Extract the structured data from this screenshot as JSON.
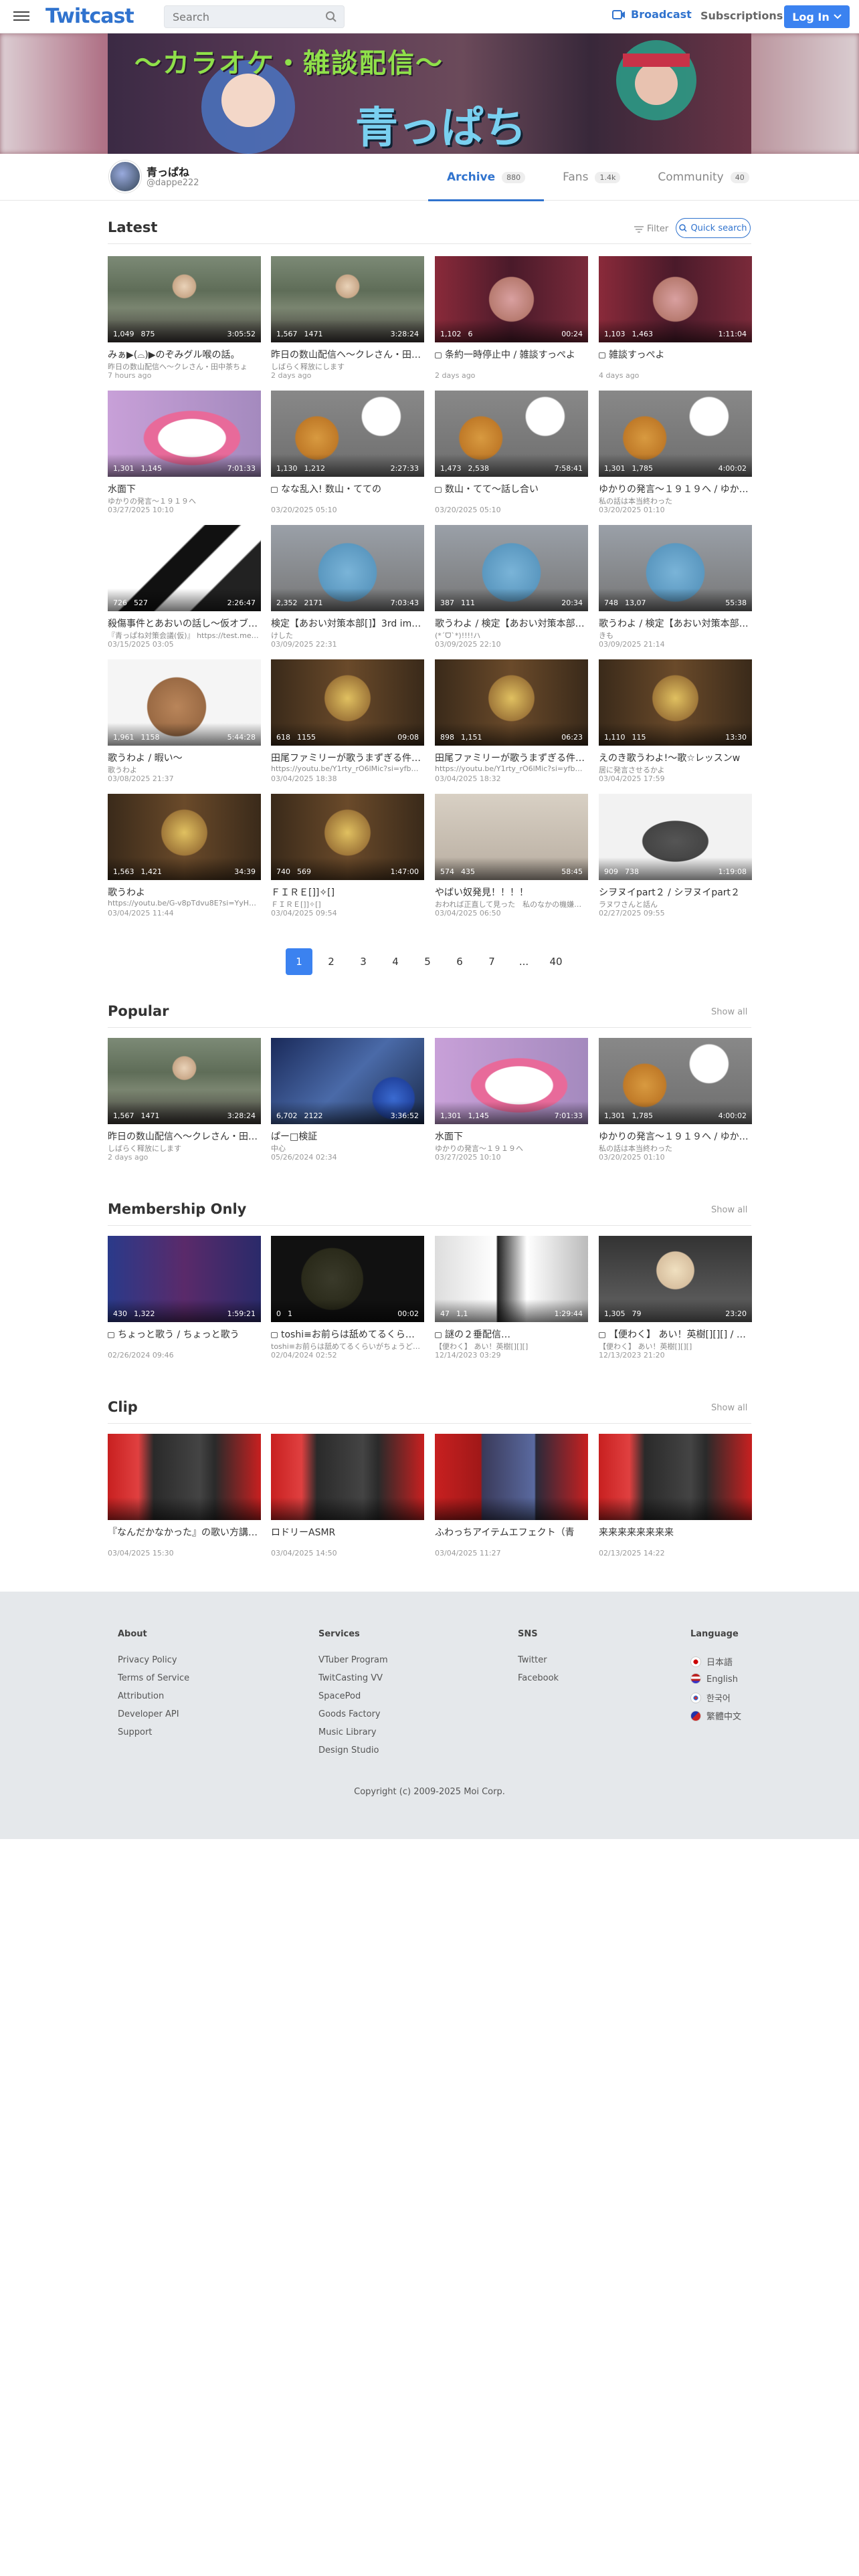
{
  "header": {
    "logo": "Twitcast",
    "search_placeholder": "Search",
    "broadcast": "Broadcast",
    "subscriptions": "Subscriptions",
    "login": "Log In"
  },
  "banner": {
    "title": "〜カラオケ・雑談配信〜",
    "name": "青っぱち"
  },
  "channel": {
    "name": "青っぱね",
    "id": "@dappe222"
  },
  "tabs": [
    {
      "label": "Archive",
      "count": "880"
    },
    {
      "label": "Fans",
      "count": "1.4k"
    },
    {
      "label": "Community",
      "count": "40"
    }
  ],
  "latest": {
    "title": "Latest",
    "filter": "Filter",
    "quick_search": "Quick search",
    "items": [
      {
        "title": "みぁ▶(⌓)▶のぞみグル喉の話。",
        "sub": "昨日の数山配信ヘ〜クレさん・田中茶ちょ",
        "date": "7 hours ago",
        "views": "1,049",
        "comments": "875",
        "dur": "3:05:52",
        "lock": false,
        "thumb": "t-oldman"
      },
      {
        "title": "昨日の数山配信ヘ〜クレさん・田…",
        "sub": "しばらく释放にします",
        "date": "2 days ago",
        "views": "1,567",
        "comments": "1471",
        "dur": "3:28:24",
        "lock": false,
        "thumb": "t-oldman"
      },
      {
        "title": "条約一時停止中 / 雑談すっぺよ",
        "sub": "",
        "date": "2 days ago",
        "views": "1,102",
        "comments": "6",
        "dur": "00:24",
        "lock": true,
        "thumb": "t-pig"
      },
      {
        "title": "雑談すっぺよ",
        "sub": "",
        "date": "4 days ago",
        "views": "1,103",
        "comments": "1,463",
        "dur": "1:11:04",
        "lock": true,
        "thumb": "t-pig"
      },
      {
        "title": "水面下",
        "sub": "ゆかりの発言〜１９１９へ",
        "date": "03/27/2025 10:10",
        "views": "1,301",
        "comments": "1,145",
        "dur": "7:01:33",
        "lock": false,
        "thumb": "t-melody"
      },
      {
        "title": "なな乱入! 数山・てての",
        "sub": "",
        "date": "03/20/2025 05:10",
        "views": "1,130",
        "comments": "1,212",
        "dur": "2:27:33",
        "lock": true,
        "thumb": "t-cat"
      },
      {
        "title": "数山・てて〜話し合い",
        "sub": "",
        "date": "03/20/2025 05:10",
        "views": "1,473",
        "comments": "2,538",
        "dur": "7:58:41",
        "lock": true,
        "thumb": "t-cat"
      },
      {
        "title": "ゆかりの発言〜１９１９へ / ゆかり…",
        "sub": "私の話は本当終わった",
        "date": "03/20/2025 01:10",
        "views": "1,301",
        "comments": "1,785",
        "dur": "4:00:02",
        "lock": false,
        "thumb": "t-cat"
      },
      {
        "title": "殺傷事件とあおいの話し〜仮オブ…",
        "sub": "『青っぱね対策会議(仮)』 https://test.me…",
        "date": "03/15/2025 03:05",
        "views": "726",
        "comments": "527",
        "dur": "2:26:47",
        "lock": false,
        "thumb": "t-bw"
      },
      {
        "title": "検定【あおい対策本部[]】3rd im…",
        "sub": "けした",
        "date": "03/09/2025 22:31",
        "views": "2,352",
        "comments": "2171",
        "dur": "7:03:43",
        "lock": false,
        "thumb": "t-mouse"
      },
      {
        "title": "歌うわよ / 検定【あおい対策本部…",
        "sub": "(*ˊᗜˋ*)!!!!ハ",
        "date": "03/09/2025 22:10",
        "views": "387",
        "comments": "111",
        "dur": "20:34",
        "lock": false,
        "thumb": "t-mouse"
      },
      {
        "title": "歌うわよ / 検定【あおい対策本部…",
        "sub": "きも",
        "date": "03/09/2025 21:14",
        "views": "748",
        "comments": "13,07",
        "dur": "55:38",
        "lock": false,
        "thumb": "t-mouse"
      },
      {
        "title": "歌うわよ / 暇い〜",
        "sub": "歌うわよ",
        "date": "03/08/2025 21:37",
        "views": "1,961",
        "comments": "1158",
        "dur": "5:44:28",
        "lock": false,
        "thumb": "t-otter"
      },
      {
        "title": "田尾ファミリーが歌うまずぎる件(…",
        "sub": "https://youtu.be/Y1rty_rO6lMic?si=yfb…",
        "date": "03/04/2025 18:38",
        "views": "618",
        "comments": "1155",
        "dur": "09:08",
        "lock": false,
        "thumb": "t-gold"
      },
      {
        "title": "田尾ファミリーが歌うまずぎる件(…",
        "sub": "https://youtu.be/Y1rty_rO6lMic?si=yfb…",
        "date": "03/04/2025 18:32",
        "views": "898",
        "comments": "1,151",
        "dur": "06:23",
        "lock": false,
        "thumb": "t-gold"
      },
      {
        "title": "えのき歌うわよ!〜歌☆レッスンw",
        "sub": "居に発言させるかよ",
        "date": "03/04/2025 17:59",
        "views": "1,110",
        "comments": "115",
        "dur": "13:30",
        "lock": false,
        "thumb": "t-gold"
      },
      {
        "title": "歌うわよ",
        "sub": "https://youtu.be/G-v8pTdvu8E?si=YyHG…",
        "date": "03/04/2025 11:44",
        "views": "1,563",
        "comments": "1,421",
        "dur": "34:39",
        "lock": false,
        "thumb": "t-gold"
      },
      {
        "title": "ＦＩＲＥ[]]✧[]",
        "sub": "ＦＩＲＥ[]]✧[]",
        "date": "03/04/2025 09:54",
        "views": "740",
        "comments": "569",
        "dur": "1:47:00",
        "lock": false,
        "thumb": "t-gold"
      },
      {
        "title": "やばい奴発見！！！！",
        "sub": "おわれば正直して見った　私のなかの機嫌…",
        "date": "03/04/2025 06:50",
        "views": "574",
        "comments": "435",
        "dur": "58:45",
        "lock": false,
        "thumb": "t-kanji"
      },
      {
        "title": "シヲヌイpart２ / シヲヌイpart２",
        "sub": "ラヌワさんと話ん",
        "date": "02/27/2025 09:55",
        "views": "909",
        "comments": "738",
        "dur": "1:19:08",
        "lock": false,
        "thumb": "t-fish"
      }
    ]
  },
  "pager": [
    "1",
    "2",
    "3",
    "4",
    "5",
    "6",
    "7",
    "...",
    "40"
  ],
  "popular": {
    "title": "Popular",
    "show_all": "Show all",
    "items": [
      {
        "title": "昨日の数山配信ヘ〜クレさん・田…",
        "sub": "しばらく释放にします",
        "date": "2 days ago",
        "views": "1,567",
        "comments": "1471",
        "dur": "3:28:24",
        "lock": false,
        "thumb": "t-oldman"
      },
      {
        "title": "ぱー□検証",
        "sub": "中心",
        "date": "05/26/2024 02:34",
        "views": "6,702",
        "comments": "2122",
        "dur": "3:36:52",
        "lock": false,
        "thumb": "t-desk"
      },
      {
        "title": "水面下",
        "sub": "ゆかりの発言〜１９１９へ",
        "date": "03/27/2025 10:10",
        "views": "1,301",
        "comments": "1,145",
        "dur": "7:01:33",
        "lock": false,
        "thumb": "t-melody"
      },
      {
        "title": "ゆかりの発言〜１９１９へ / ゆかり…",
        "sub": "私の話は本当終わった",
        "date": "03/20/2025 01:10",
        "views": "1,301",
        "comments": "1,785",
        "dur": "4:00:02",
        "lock": false,
        "thumb": "t-cat"
      }
    ]
  },
  "membership": {
    "title": "Membership Only",
    "show_all": "Show all",
    "items": [
      {
        "title": "ちょっと歌う / ちょっと歌う",
        "sub": "",
        "date": "02/26/2024 09:46",
        "views": "430",
        "comments": "1,322",
        "dur": "1:59:21",
        "lock": true,
        "thumb": "t-anime"
      },
      {
        "title": "toshi≡お前らは舐めてるくら…",
        "sub": "toshi≡お前らは舐めてるくらいがちょうど…",
        "date": "02/04/2024 02:52",
        "views": "0",
        "comments": "1",
        "dur": "00:02",
        "lock": true,
        "thumb": "t-dark"
      },
      {
        "title": "謎の２垂配信…",
        "sub": "【便わく】 あい！英樹[][][]",
        "date": "12/14/2023 03:29",
        "views": "47",
        "comments": "1,1",
        "dur": "1:29:44",
        "lock": true,
        "thumb": "t-nbw"
      },
      {
        "title": "【便わく】 あい！英樹[][][] / あ…",
        "sub": "【便わく】 あい！英樹[][][]",
        "date": "12/13/2023 21:20",
        "views": "1,305",
        "comments": "79",
        "dur": "23:20",
        "lock": true,
        "thumb": "t-hat"
      }
    ]
  },
  "clip": {
    "title": "Clip",
    "show_all": "Show all",
    "items": [
      {
        "title": "『なんだかなかった』の歌い方講座(",
        "sub": "",
        "date": "03/04/2025 15:30",
        "thumb": "t-clip"
      },
      {
        "title": "ロドリーASMR",
        "sub": "",
        "date": "03/04/2025 14:50",
        "thumb": "t-clip"
      },
      {
        "title": "ふわっちアイテムエフェクト（青",
        "sub": "",
        "date": "03/04/2025 11:27",
        "thumb": "t-clip2"
      },
      {
        "title": "来来来来来来来来",
        "sub": "",
        "date": "02/13/2025 14:22",
        "thumb": "t-clip"
      }
    ]
  },
  "footer": {
    "about": {
      "title": "About",
      "items": [
        "Privacy Policy",
        "Terms of Service",
        "Attribution",
        "Developer API",
        "Support"
      ]
    },
    "services": {
      "title": "Services",
      "items": [
        "VTuber Program",
        "TwitCasting VV",
        "SpacePod",
        "Goods Factory",
        "Music Library",
        "Design Studio"
      ]
    },
    "sns": {
      "title": "SNS",
      "items": [
        "Twitter",
        "Facebook"
      ]
    },
    "language": {
      "title": "Language",
      "items": [
        "日本語",
        "English",
        "한국어",
        "繁體中文"
      ]
    },
    "copyright": "Copyright (c) 2009-2025 Moi Corp."
  }
}
